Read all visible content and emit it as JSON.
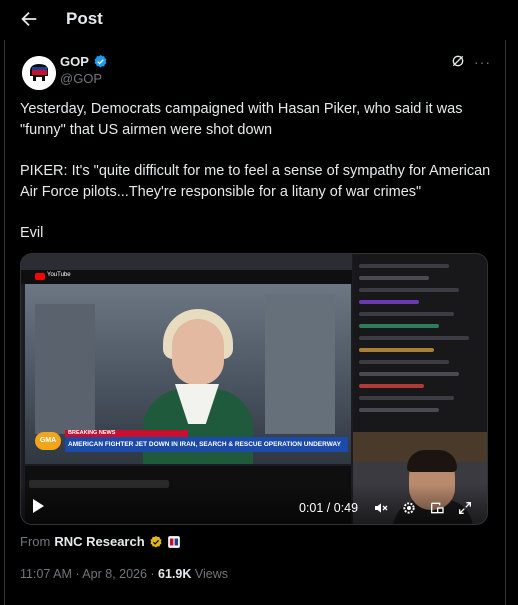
{
  "header": {
    "title": "Post"
  },
  "author": {
    "name": "GOP",
    "handle": "@GOP"
  },
  "tweet": {
    "line1": "Yesterday, Democrats campaigned with Hasan Piker, who said it was\n\"funny\" that US airmen were shot down",
    "line2": "PIKER: It's \"quite difficult for me to feel a sense of sympathy for American\nAir Force pilots...They're responsible for a litany of war crimes\"",
    "line3": "Evil"
  },
  "video": {
    "time": "0:01 / 0:49",
    "gma_logo": "GMA",
    "breaking": "BREAKING NEWS",
    "headline": "AMERICAN FIGHTER JET DOWN IN IRAN, SEARCH & RESCUE OPERATION UNDERWAY",
    "yt_name": "YouTube"
  },
  "source": {
    "prefix": "From",
    "name": "RNC Research"
  },
  "meta": {
    "time": "11:07 AM · Apr 8, 2026 · ",
    "views_count": "61.9K",
    "views_label": " Views"
  },
  "colors": {
    "verified_blue": "#1d9bf0",
    "verified_gold": "#e2b719",
    "text_primary": "#e7e9ea",
    "text_secondary": "#71767b"
  },
  "icons": [
    "back-arrow-icon",
    "verified-badge-icon",
    "grok-icon",
    "more-icon",
    "play-icon",
    "mute-icon",
    "settings-icon",
    "pip-icon",
    "fullscreen-icon",
    "gold-badge-icon",
    "affiliate-icon"
  ]
}
